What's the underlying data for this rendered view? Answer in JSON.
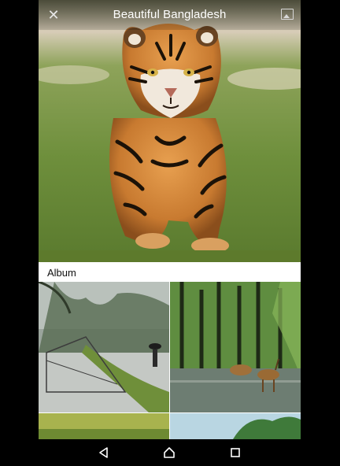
{
  "header": {
    "title": "Beautiful Bangladesh",
    "close_icon": "close-icon",
    "gallery_icon": "image-gallery-icon"
  },
  "album": {
    "label": "Album"
  },
  "navigation": {
    "back_icon": "back-triangle-icon",
    "home_icon": "home-icon",
    "recents_icon": "recents-square-icon"
  },
  "colors": {
    "topbar_tint": "#3a3a3a",
    "grass": "#6b8a3a",
    "tiger_orange": "#c8782e"
  }
}
